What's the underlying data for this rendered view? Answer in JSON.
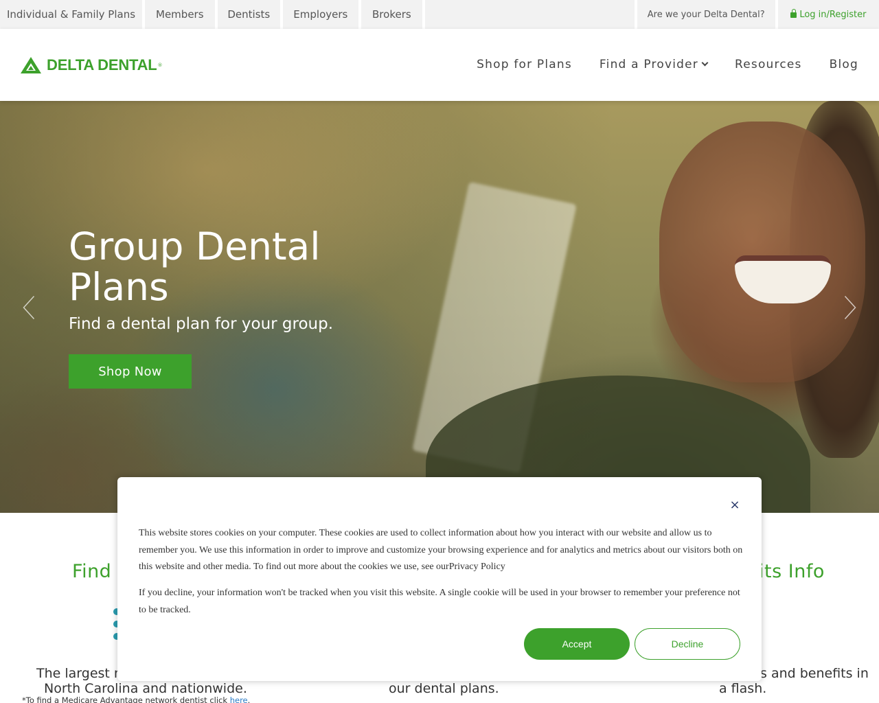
{
  "utility_bar": {
    "tabs": [
      "Individual & Family Plans",
      "Members",
      "Dentists",
      "Employers",
      "Brokers"
    ],
    "question": "Are we your Delta Dental?",
    "login": "Log in/Register"
  },
  "header": {
    "logo_text": "DELTA DENTAL",
    "logo_reg": "®",
    "nav": [
      "Shop for Plans",
      "Find a Provider",
      "Resources",
      "Blog"
    ]
  },
  "hero": {
    "title": "Group Dental Plans",
    "subtitle": "Find a dental plan for your group.",
    "cta": "Shop Now"
  },
  "features": {
    "left_heading": "Find",
    "right_heading": "its Info",
    "left_text_line1": "The largest n",
    "left_text_line2": "North Carolina and nationwide.",
    "middle_text_line2": "our dental plans.",
    "right_text_line1": "s and benefits in",
    "right_text_line2": "a flash.",
    "footnote": "*To find a Medicare Advantage network dentist click ",
    "footnote_link": "here",
    "footnote_end": "."
  },
  "cookie_dialog": {
    "close_glyph": "×",
    "paragraph1": "This website stores cookies on your computer. These cookies are used to collect information about how you interact with our website and allow us to remember you. We use this information in order to improve and customize your browsing experience and for analytics and metrics about our visitors both on this website and other media. To find out more about the cookies we use, see ourPrivacy Policy",
    "paragraph2": "If you decline, your information won't be tracked when you visit this website. A single cookie will be used in your browser to remember your preference not to be tracked.",
    "accept": "Accept",
    "decline": "Decline"
  },
  "colors": {
    "brand_green": "#3da12c",
    "utility_gray": "#f2f2f2",
    "accent_teal": "#2a9db0"
  },
  "icons": {
    "lock": "lock-icon",
    "chevron": "chevron-down-icon",
    "close": "close-icon",
    "arrow_left": "arrow-left-icon",
    "arrow_right": "arrow-right-icon"
  }
}
